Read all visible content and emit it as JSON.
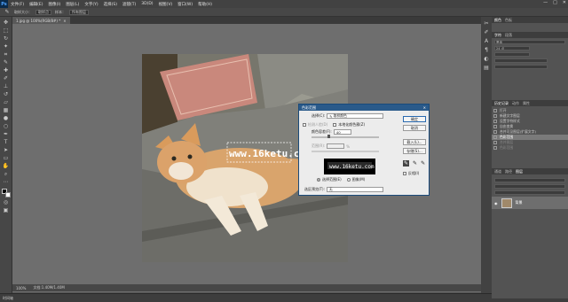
{
  "menubar": {
    "logo": "Ps",
    "items": [
      "文件(F)",
      "编辑(E)",
      "图像(I)",
      "图层(L)",
      "文字(Y)",
      "选择(S)",
      "滤镜(T)",
      "3D(D)",
      "视图(V)",
      "窗口(W)",
      "帮助(H)"
    ],
    "controls": [
      "—",
      "□",
      "✕"
    ]
  },
  "options": {
    "size_label": "取样大小：",
    "size_value": "取样点",
    "sample_label": "样本：",
    "sample_value": "所有图层"
  },
  "document": {
    "tab_title": "1.jpg @ 100%(RGB/8#) *",
    "tab_close": "×",
    "zoom": "100%",
    "doc_info": "文档:1.40M/1.40M"
  },
  "timeline": {
    "label": "时间轴"
  },
  "watermark": "www.16ketu.com",
  "preview_text": "www.16ketu.com",
  "dialog": {
    "title": "色彩范围",
    "select_label": "选择(C):",
    "select_value": "取样颜色",
    "localized_label": "检测人脸(D)",
    "localized2_label": "本地化颜色簇(Z)",
    "fuzziness_label": "颜色容差(F):",
    "fuzziness_value": "40",
    "range_label": "范围(R):",
    "range_unit": "%",
    "radio_selection": "选择范围(E)",
    "radio_image": "图像(M)",
    "preview_label": "选区预览(T):",
    "preview_value": "无",
    "btn_ok": "确定",
    "btn_cancel": "取消",
    "btn_load": "载入(L)...",
    "btn_save": "存储(S)...",
    "invert_label": "反相(I)"
  },
  "panels": {
    "color_tabs": [
      "颜色",
      "色板"
    ],
    "char_tabs": [
      "字符",
      "段落"
    ],
    "char_font": "黑体",
    "char_size": "24 点",
    "history_tabs": [
      "历史记录",
      "动作",
      "属性"
    ],
    "history_items": [
      {
        "label": "打开",
        "state": "normal"
      },
      {
        "label": "新建文字图层",
        "state": "normal"
      },
      {
        "label": "设置字符样式",
        "state": "normal"
      },
      {
        "label": "自由变换",
        "state": "normal"
      },
      {
        "label": "合并可见图层(扩展文字)",
        "state": "normal"
      },
      {
        "label": "色彩范围",
        "state": "selected"
      },
      {
        "label": "合并图层",
        "state": "dim"
      },
      {
        "label": "色彩范围",
        "state": "dim"
      }
    ],
    "layers_tabs": [
      "通道",
      "路径",
      "图层"
    ],
    "layer_name": "背景"
  }
}
